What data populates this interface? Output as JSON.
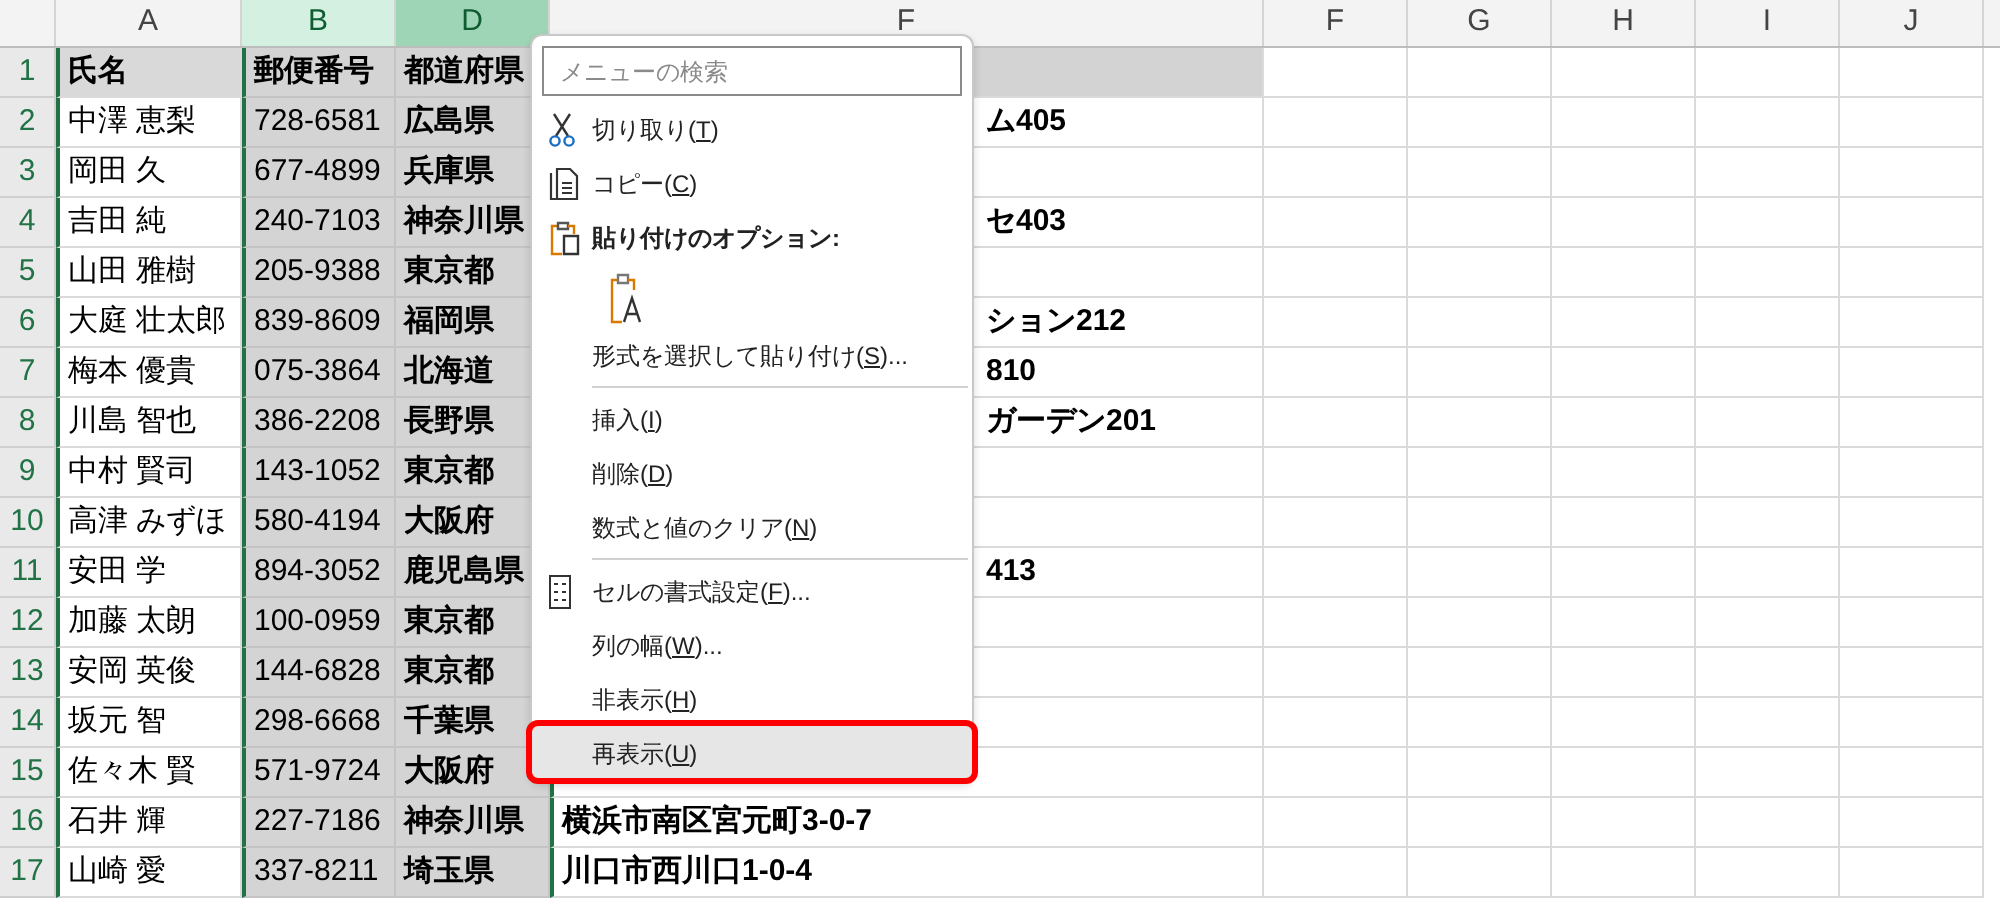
{
  "sheet": {
    "columns": [
      {
        "label": "A",
        "selected": false
      },
      {
        "label": "B",
        "selected": true
      },
      {
        "label": "D",
        "selected": true
      },
      {
        "label": "F",
        "selected": false
      },
      {
        "label": "F",
        "selected": false
      },
      {
        "label": "G",
        "selected": false
      },
      {
        "label": "H",
        "selected": false
      },
      {
        "label": "I",
        "selected": false
      },
      {
        "label": "J",
        "selected": false
      }
    ],
    "rows": [
      {
        "number": "1",
        "cells": [
          "氏名",
          "郵便番号",
          "都道府県",
          ""
        ]
      },
      {
        "number": "2",
        "cells": [
          "中澤 恵梨",
          "728-6581",
          "広島県",
          "ム405"
        ]
      },
      {
        "number": "3",
        "cells": [
          "岡田 久",
          "677-4899",
          "兵庫県",
          ""
        ]
      },
      {
        "number": "4",
        "cells": [
          "吉田 純",
          "240-7103",
          "神奈川県",
          "セ403"
        ]
      },
      {
        "number": "5",
        "cells": [
          "山田 雅樹",
          "205-9388",
          "東京都",
          ""
        ]
      },
      {
        "number": "6",
        "cells": [
          "大庭 壮太郎",
          "839-8609",
          "福岡県",
          "ション212"
        ]
      },
      {
        "number": "7",
        "cells": [
          "梅本 優貴",
          "075-3864",
          "北海道",
          "810"
        ]
      },
      {
        "number": "8",
        "cells": [
          "川島 智也",
          "386-2208",
          "長野県",
          "ガーデン201"
        ]
      },
      {
        "number": "9",
        "cells": [
          "中村 賢司",
          "143-1052",
          "東京都",
          ""
        ]
      },
      {
        "number": "10",
        "cells": [
          "高津 みずほ",
          "580-4194",
          "大阪府",
          ""
        ]
      },
      {
        "number": "11",
        "cells": [
          "安田 学",
          "894-3052",
          "鹿児島県",
          "413"
        ]
      },
      {
        "number": "12",
        "cells": [
          "加藤 太朗",
          "100-0959",
          "東京都",
          ""
        ]
      },
      {
        "number": "13",
        "cells": [
          "安岡 英俊",
          "144-6828",
          "東京都",
          ""
        ]
      },
      {
        "number": "14",
        "cells": [
          "坂元 智",
          "298-6668",
          "千葉県",
          ""
        ]
      },
      {
        "number": "15",
        "cells": [
          "佐々木 賢",
          "571-9724",
          "大阪府",
          ""
        ]
      },
      {
        "number": "16",
        "cells": [
          "石井 輝",
          "227-7186",
          "神奈川県",
          "横浜市南区宮元町3-0-7"
        ]
      },
      {
        "number": "17",
        "cells": [
          "山崎 愛",
          "337-8211",
          "埼玉県",
          "川口市西川口1-0-4"
        ]
      }
    ]
  },
  "context_menu": {
    "search": {
      "placeholder": "メニューの検索"
    },
    "items": [
      {
        "kind": "cut",
        "before": "切り取り(",
        "key": "T",
        "after": ")",
        "selected": false
      },
      {
        "kind": "copy",
        "before": "コピー(",
        "key": "C",
        "after": ")",
        "selected": false
      },
      {
        "kind": "heading",
        "before": "貼り付けのオプション:",
        "selected": false
      },
      {
        "kind": "paste-button",
        "selected": false
      },
      {
        "kind": "item",
        "before": "形式を選択して貼り付け(",
        "key": "S",
        "after": ")...",
        "selected": false
      },
      {
        "kind": "separator"
      },
      {
        "kind": "item",
        "before": "挿入(",
        "key": "I",
        "after": ")",
        "selected": false
      },
      {
        "kind": "item",
        "before": "削除(",
        "key": "D",
        "after": ")",
        "selected": false
      },
      {
        "kind": "item",
        "before": "数式と値のクリア(",
        "key": "N",
        "after": ")",
        "selected": false
      },
      {
        "kind": "separator"
      },
      {
        "kind": "format",
        "before": "セルの書式設定(",
        "key": "F",
        "after": ")...",
        "selected": false
      },
      {
        "kind": "item",
        "before": "列の幅(",
        "key": "W",
        "after": ")...",
        "selected": false
      },
      {
        "kind": "item",
        "before": "非表示(",
        "key": "H",
        "after": ")",
        "selected": false
      },
      {
        "kind": "item",
        "before": "再表示(",
        "key": "U",
        "after": ")",
        "selected": true
      }
    ]
  }
}
